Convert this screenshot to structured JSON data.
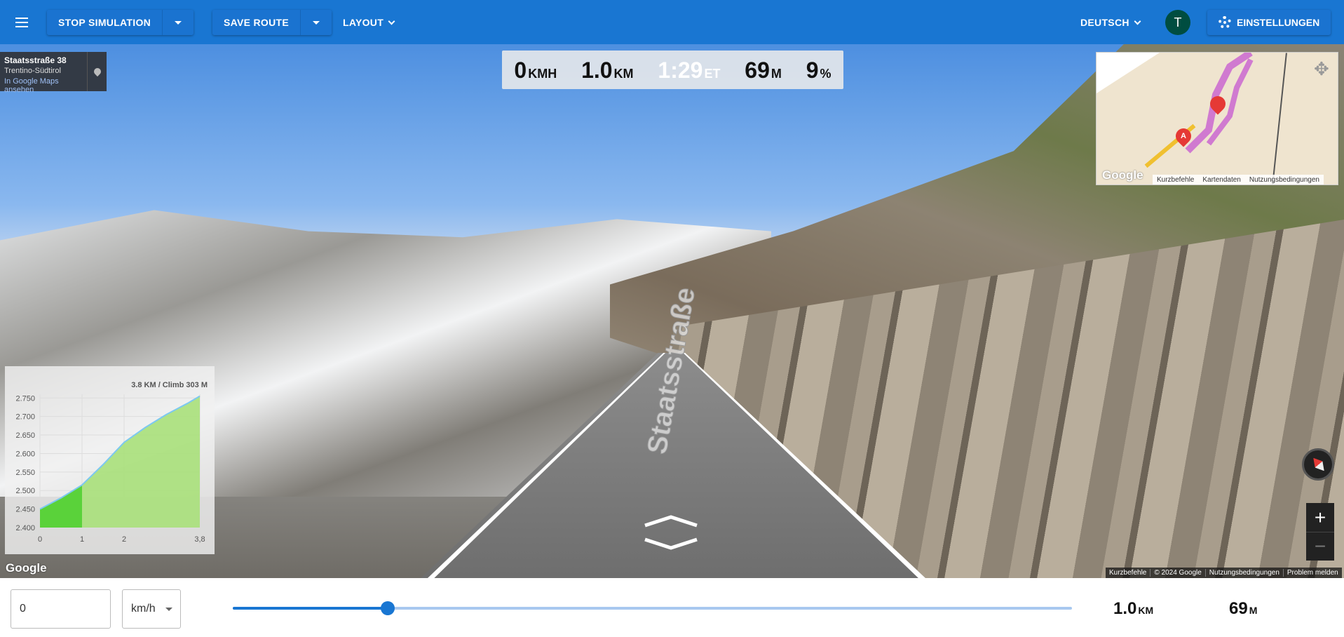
{
  "toolbar": {
    "menu_icon": "hamburger-menu-icon",
    "stop_simulation_label": "STOP SIMULATION",
    "save_route_label": "SAVE ROUTE",
    "layout_label": "LAYOUT",
    "language_label": "DEUTSCH",
    "avatar_initial": "T",
    "settings_label": "EINSTELLUNGEN",
    "accent_color": "#1976d2"
  },
  "stats": {
    "speed": {
      "value": "0",
      "unit": "KMH"
    },
    "distance": {
      "value": "1.0",
      "unit": "KM"
    },
    "time": {
      "value": "1:29",
      "unit": "ET"
    },
    "elevation": {
      "value": "69",
      "unit": "M"
    },
    "grade": {
      "value": "9",
      "unit": "%"
    }
  },
  "location": {
    "title": "Staatsstraße 38",
    "region": "Trentino-Südtirol",
    "link": "In Google Maps ansehen"
  },
  "minimap": {
    "marker_a": "A",
    "google_logo": "Google",
    "footer": [
      "Kurzbefehle",
      "Kartendaten",
      "Nutzungsbedingungen"
    ]
  },
  "elevation_chart": {
    "header": "3.8 KM / Climb 303 M"
  },
  "chart_data": {
    "type": "area",
    "title": "3.8 KM / Climb 303 M",
    "xlabel": "",
    "ylabel": "",
    "x_ticks": [
      "0",
      "1",
      "2",
      "3,8"
    ],
    "y_ticks": [
      "2.400",
      "2.450",
      "2.500",
      "2.550",
      "2.600",
      "2.650",
      "2.700",
      "2.750"
    ],
    "xlim": [
      0,
      3.8
    ],
    "ylim": [
      2400,
      2760
    ],
    "series": [
      {
        "x": [
          0,
          0.5,
          1.0,
          1.5,
          2.0,
          2.5,
          3.0,
          3.5,
          3.8
        ],
        "y": [
          2450,
          2480,
          2515,
          2570,
          2630,
          2670,
          2705,
          2735,
          2755
        ]
      }
    ],
    "completed_until_km": 1.0,
    "colors": {
      "completed": "#5ad23a",
      "remaining": "#a8e07a",
      "line": "#7cc8f0"
    }
  },
  "street_view": {
    "road_text": "Staatsstraße",
    "google_logo": "Google",
    "attributions": [
      "Kurzbefehle",
      "© 2024 Google",
      "Nutzungsbedingungen",
      "Problem melden"
    ]
  },
  "bottom": {
    "speed_value": "0",
    "unit": "km/h",
    "progress": 0.185,
    "distance": {
      "value": "1.0",
      "unit": "KM"
    },
    "elevation": {
      "value": "69",
      "unit": "M"
    }
  }
}
